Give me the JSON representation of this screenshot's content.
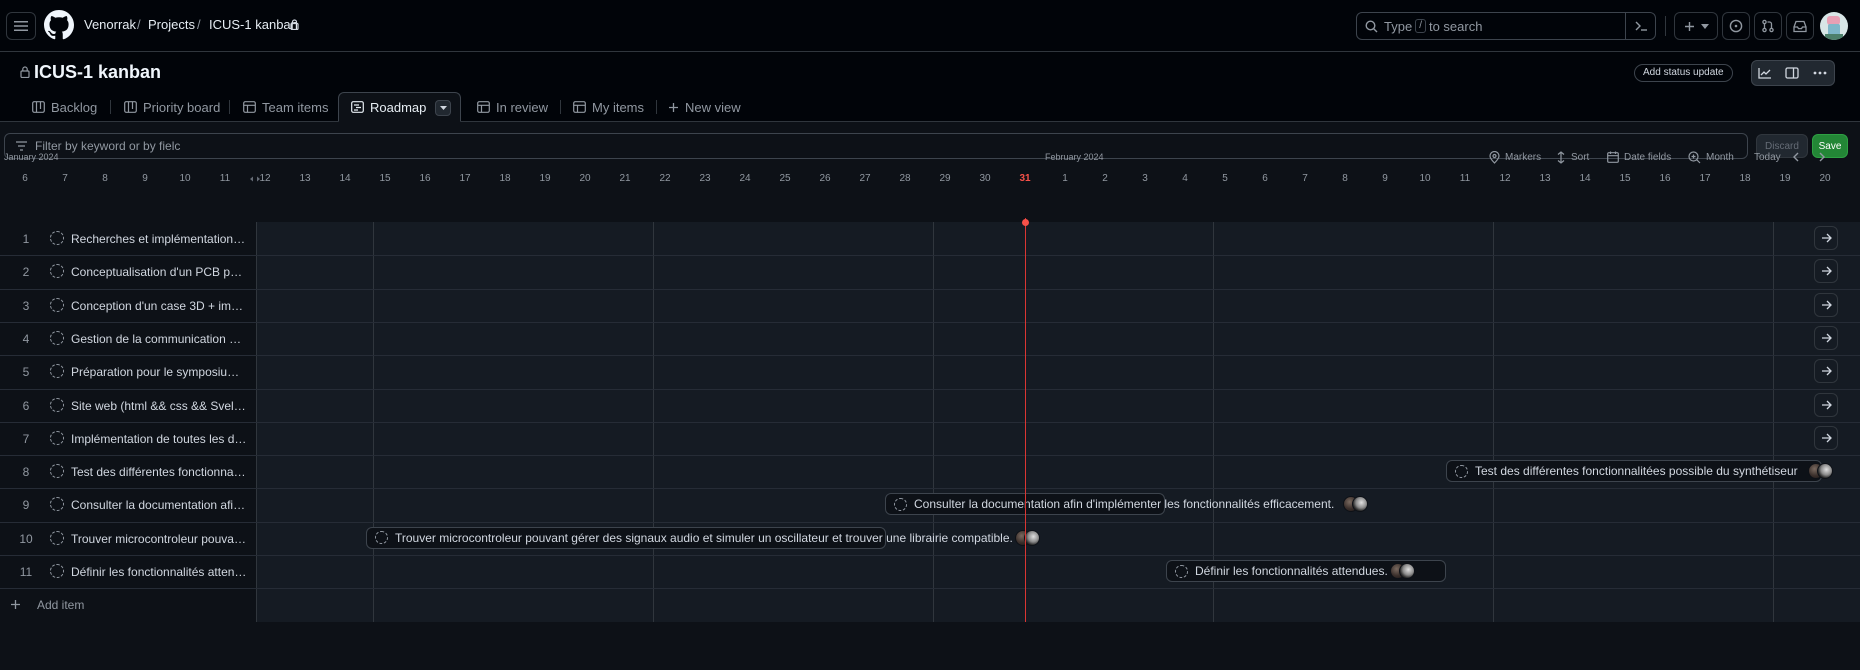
{
  "header": {
    "breadcrumbs": [
      "Venorrak",
      "Projects",
      "ICUS-1 kanban"
    ],
    "separator": "/",
    "search_placeholder_pre": "Type",
    "search_key": "/",
    "search_placeholder_post": "to search"
  },
  "project": {
    "title": "ICUS-1 kanban",
    "add_status_label": "Add status update"
  },
  "tabs": [
    {
      "label": "Backlog",
      "icon": "board-icon"
    },
    {
      "label": "Priority board",
      "icon": "board-icon"
    },
    {
      "label": "Team items",
      "icon": "table-icon"
    },
    {
      "label": "Roadmap",
      "icon": "roadmap-icon",
      "active": true
    },
    {
      "label": "In review",
      "icon": "table-icon"
    },
    {
      "label": "My items",
      "icon": "table-icon"
    },
    {
      "label": "New view",
      "icon": "plus-icon"
    }
  ],
  "filter": {
    "placeholder": "Filter by keyword or by fielc",
    "discard_label": "Discard",
    "save_label": "Save"
  },
  "timeline": {
    "months": [
      "January 2024",
      "February 2024"
    ],
    "days": [
      "6",
      "7",
      "8",
      "9",
      "10",
      "11",
      "12",
      "13",
      "14",
      "15",
      "16",
      "17",
      "18",
      "19",
      "20",
      "21",
      "22",
      "23",
      "24",
      "25",
      "26",
      "27",
      "28",
      "29",
      "30",
      "31",
      "1",
      "2",
      "3",
      "4",
      "5",
      "6",
      "7",
      "8",
      "9",
      "10",
      "11",
      "12",
      "13",
      "14",
      "15",
      "16",
      "17",
      "18",
      "19",
      "20"
    ],
    "today": "31",
    "controls": {
      "markers": "Markers",
      "sort": "Sort",
      "date_fields": "Date fields",
      "zoom": "Month",
      "today": "Today"
    }
  },
  "rows": [
    {
      "num": "1",
      "title": "Recherches et implémentation …"
    },
    {
      "num": "2",
      "title": "Conceptualisation d'un PCB po…"
    },
    {
      "num": "3",
      "title": "Conception d'un case 3D + im…"
    },
    {
      "num": "4",
      "title": "Gestion de la communication …"
    },
    {
      "num": "5",
      "title": "Préparation pour le symposium…"
    },
    {
      "num": "6",
      "title": "Site web (html && css && Svel…"
    },
    {
      "num": "7",
      "title": "Implémentation de toutes les d…"
    },
    {
      "num": "8",
      "title": "Test des différentes fonctionnal…"
    },
    {
      "num": "9",
      "title": "Consulter la documentation afi…"
    },
    {
      "num": "10",
      "title": "Trouver microcontroleur pouva…"
    },
    {
      "num": "11",
      "title": "Définir les fonctionnalités atten…"
    }
  ],
  "bars": [
    {
      "row": 8,
      "label": "Test des différentes fonctionnalitées possible du synthétiseur"
    },
    {
      "row": 9,
      "label": "Consulter la documentation afin d'implémenter les fonctionnalités efficacement."
    },
    {
      "row": 10,
      "label": "Trouver microcontroleur pouvant gérer des signaux audio et simuler un oscillateur et trouver une librairie compatible."
    },
    {
      "row": 11,
      "label": "Définir les fonctionnalités attendues."
    }
  ],
  "add_item_label": "Add item",
  "colors": {
    "today_marker": "#f85149",
    "save_green": "#238636"
  }
}
